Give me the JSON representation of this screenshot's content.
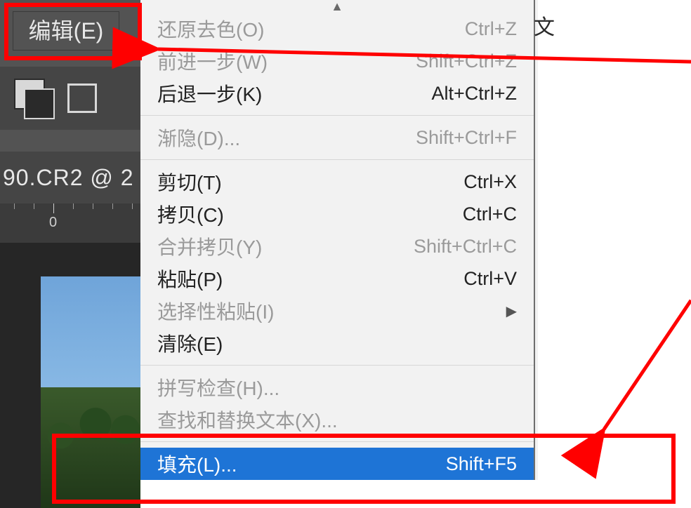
{
  "ps": {
    "edit_menu_label": "编辑(E)",
    "doc_title": "90.CR2 @ 2",
    "ruler_zero": "0"
  },
  "right_sliver_char": "文",
  "menu": {
    "undo": {
      "label": "还原去色(O)",
      "shortcut": "Ctrl+Z"
    },
    "step_fwd": {
      "label": "前进一步(W)",
      "shortcut": "Shift+Ctrl+Z"
    },
    "step_back": {
      "label": "后退一步(K)",
      "shortcut": "Alt+Ctrl+Z"
    },
    "fade": {
      "label": "渐隐(D)...",
      "shortcut": "Shift+Ctrl+F"
    },
    "cut": {
      "label": "剪切(T)",
      "shortcut": "Ctrl+X"
    },
    "copy": {
      "label": "拷贝(C)",
      "shortcut": "Ctrl+C"
    },
    "copy_merge": {
      "label": "合并拷贝(Y)",
      "shortcut": "Shift+Ctrl+C"
    },
    "paste": {
      "label": "粘贴(P)",
      "shortcut": "Ctrl+V"
    },
    "paste_spec": {
      "label": "选择性粘贴(I)",
      "submenu": true
    },
    "clear": {
      "label": "清除(E)"
    },
    "spellcheck": {
      "label": "拼写检查(H)..."
    },
    "findreplace": {
      "label": "查找和替换文本(X)..."
    },
    "fill": {
      "label": "填充(L)...",
      "shortcut": "Shift+F5"
    }
  }
}
